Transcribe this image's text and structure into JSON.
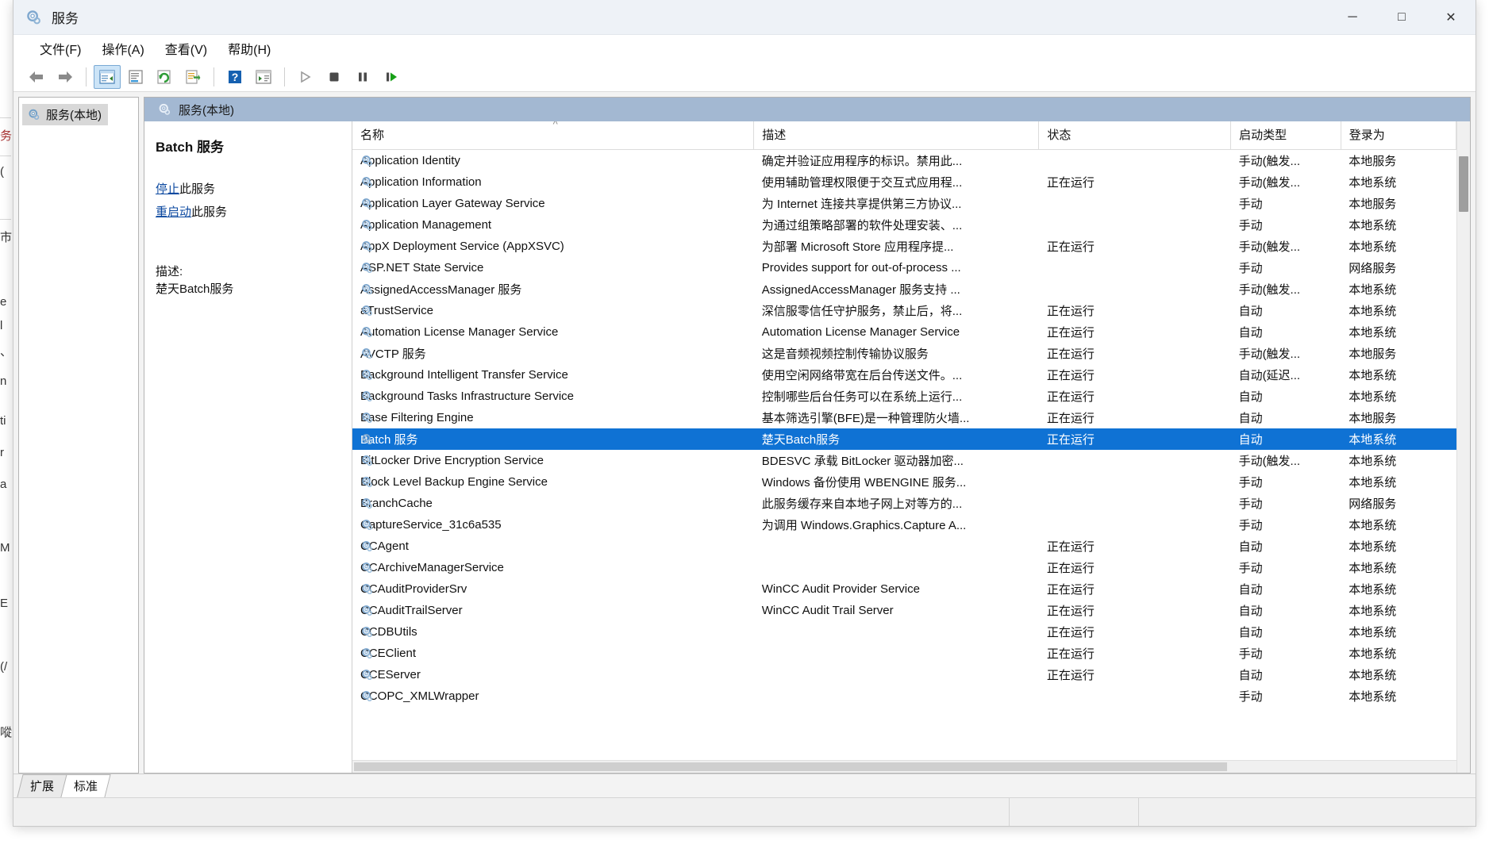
{
  "window": {
    "title": "服务",
    "icon": "services-gear-icon",
    "minimize_label": "─",
    "maximize_label": "□",
    "close_label": "✕"
  },
  "menubar": {
    "items": [
      {
        "name": "file",
        "label": "文件(F)"
      },
      {
        "name": "action",
        "label": "操作(A)"
      },
      {
        "name": "view",
        "label": "查看(V)"
      },
      {
        "name": "help",
        "label": "帮助(H)"
      }
    ]
  },
  "toolbar": {
    "buttons": [
      {
        "name": "back-button",
        "icon": "left-arrow-icon"
      },
      {
        "name": "forward-button",
        "icon": "right-arrow-icon"
      },
      {
        "name": "show-hide-tree-button",
        "icon": "console-tree-icon",
        "active": true
      },
      {
        "name": "properties-button",
        "icon": "properties-icon"
      },
      {
        "name": "refresh-button",
        "icon": "refresh-icon"
      },
      {
        "name": "export-list-button",
        "icon": "export-list-icon"
      },
      {
        "name": "help-button",
        "icon": "question-mark-icon"
      },
      {
        "name": "show-action-pane-button",
        "icon": "action-pane-icon"
      },
      {
        "name": "start-service-button",
        "icon": "play-icon"
      },
      {
        "name": "stop-service-button",
        "icon": "stop-icon"
      },
      {
        "name": "pause-service-button",
        "icon": "pause-icon"
      },
      {
        "name": "restart-service-button",
        "icon": "restart-icon"
      }
    ]
  },
  "tree": {
    "root_label": "服务(本地)",
    "root_icon": "services-gear-icon"
  },
  "list_pane": {
    "header_label": "服务(本地)",
    "header_icon": "services-gear-icon"
  },
  "details": {
    "title": "Batch 服务",
    "stop_link": "停止",
    "stop_suffix": "此服务",
    "restart_link": "重启动",
    "restart_suffix": "此服务",
    "description_label": "描述:",
    "description_text": "楚天Batch服务"
  },
  "table": {
    "columns": [
      {
        "key": "name",
        "label": "名称",
        "sorted": true
      },
      {
        "key": "desc",
        "label": "描述",
        "sorted": false
      },
      {
        "key": "status",
        "label": "状态",
        "sorted": false
      },
      {
        "key": "start",
        "label": "启动类型",
        "sorted": false
      },
      {
        "key": "logon",
        "label": "登录为",
        "sorted": false
      }
    ],
    "rows": [
      {
        "name": "Application Identity",
        "desc": "确定并验证应用程序的标识。禁用此...",
        "status": "",
        "start": "手动(触发...",
        "logon": "本地服务",
        "selected": false
      },
      {
        "name": "Application Information",
        "desc": "使用辅助管理权限便于交互式应用程...",
        "status": "正在运行",
        "start": "手动(触发...",
        "logon": "本地系统",
        "selected": false
      },
      {
        "name": "Application Layer Gateway Service",
        "desc": "为 Internet 连接共享提供第三方协议...",
        "status": "",
        "start": "手动",
        "logon": "本地服务",
        "selected": false
      },
      {
        "name": "Application Management",
        "desc": "为通过组策略部署的软件处理安装、...",
        "status": "",
        "start": "手动",
        "logon": "本地系统",
        "selected": false
      },
      {
        "name": "AppX Deployment Service (AppXSVC)",
        "desc": "为部署 Microsoft Store 应用程序提...",
        "status": "正在运行",
        "start": "手动(触发...",
        "logon": "本地系统",
        "selected": false
      },
      {
        "name": "ASP.NET State Service",
        "desc": "Provides support for out-of-process ...",
        "status": "",
        "start": "手动",
        "logon": "网络服务",
        "selected": false
      },
      {
        "name": "AssignedAccessManager 服务",
        "desc": "AssignedAccessManager 服务支持 ...",
        "status": "",
        "start": "手动(触发...",
        "logon": "本地系统",
        "selected": false
      },
      {
        "name": "aTrustService",
        "desc": "深信服零信任守护服务，禁止后，将...",
        "status": "正在运行",
        "start": "自动",
        "logon": "本地系统",
        "selected": false
      },
      {
        "name": "Automation License Manager Service",
        "desc": "Automation License Manager Service",
        "status": "正在运行",
        "start": "自动",
        "logon": "本地系统",
        "selected": false
      },
      {
        "name": "AVCTP 服务",
        "desc": "这是音频视频控制传输协议服务",
        "status": "正在运行",
        "start": "手动(触发...",
        "logon": "本地服务",
        "selected": false
      },
      {
        "name": "Background Intelligent Transfer Service",
        "desc": "使用空闲网络带宽在后台传送文件。...",
        "status": "正在运行",
        "start": "自动(延迟...",
        "logon": "本地系统",
        "selected": false
      },
      {
        "name": "Background Tasks Infrastructure Service",
        "desc": "控制哪些后台任务可以在系统上运行...",
        "status": "正在运行",
        "start": "自动",
        "logon": "本地系统",
        "selected": false
      },
      {
        "name": "Base Filtering Engine",
        "desc": "基本筛选引擎(BFE)是一种管理防火墙...",
        "status": "正在运行",
        "start": "自动",
        "logon": "本地服务",
        "selected": false
      },
      {
        "name": "Batch 服务",
        "desc": "楚天Batch服务",
        "status": "正在运行",
        "start": "自动",
        "logon": "本地系统",
        "selected": true
      },
      {
        "name": "BitLocker Drive Encryption Service",
        "desc": "BDESVC 承载 BitLocker 驱动器加密...",
        "status": "",
        "start": "手动(触发...",
        "logon": "本地系统",
        "selected": false
      },
      {
        "name": "Block Level Backup Engine Service",
        "desc": "Windows 备份使用 WBENGINE 服务...",
        "status": "",
        "start": "手动",
        "logon": "本地系统",
        "selected": false
      },
      {
        "name": "BranchCache",
        "desc": "此服务缓存来自本地子网上对等方的...",
        "status": "",
        "start": "手动",
        "logon": "网络服务",
        "selected": false
      },
      {
        "name": "CaptureService_31c6a535",
        "desc": "为调用 Windows.Graphics.Capture A...",
        "status": "",
        "start": "手动",
        "logon": "本地系统",
        "selected": false
      },
      {
        "name": "CCAgent",
        "desc": "",
        "status": "正在运行",
        "start": "自动",
        "logon": "本地系统",
        "selected": false
      },
      {
        "name": "CCArchiveManagerService",
        "desc": "",
        "status": "正在运行",
        "start": "手动",
        "logon": "本地系统",
        "selected": false
      },
      {
        "name": "CCAuditProviderSrv",
        "desc": "WinCC Audit Provider Service",
        "status": "正在运行",
        "start": "自动",
        "logon": "本地系统",
        "selected": false
      },
      {
        "name": "CCAuditTrailServer",
        "desc": "WinCC Audit Trail Server",
        "status": "正在运行",
        "start": "自动",
        "logon": "本地系统",
        "selected": false
      },
      {
        "name": "CCDBUtils",
        "desc": "",
        "status": "正在运行",
        "start": "自动",
        "logon": "本地系统",
        "selected": false
      },
      {
        "name": "CCEClient",
        "desc": "",
        "status": "正在运行",
        "start": "手动",
        "logon": "本地系统",
        "selected": false
      },
      {
        "name": "CCEServer",
        "desc": "",
        "status": "正在运行",
        "start": "自动",
        "logon": "本地系统",
        "selected": false
      },
      {
        "name": "CCOPC_XMLWrapper",
        "desc": "",
        "status": "",
        "start": "手动",
        "logon": "本地系统",
        "selected": false
      }
    ]
  },
  "tabs": [
    {
      "name": "tab-extended",
      "label": "扩展",
      "active": false
    },
    {
      "name": "tab-standard",
      "label": "标准",
      "active": true
    }
  ],
  "background_app": {
    "fragments": [
      "务讠",
      "(",
      "市",
      "e",
      "、l",
      "n",
      "ti",
      "r",
      "a",
      "M",
      "E",
      "(/",
      "㗰"
    ]
  }
}
